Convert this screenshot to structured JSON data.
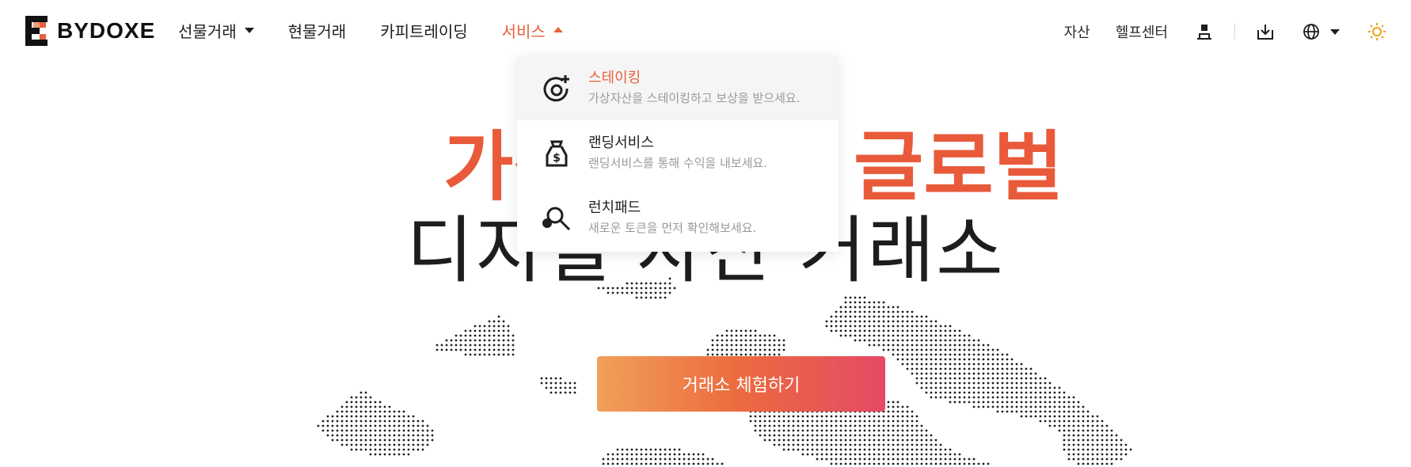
{
  "brand": {
    "name": "BYDOXE",
    "accent": "#e8613c"
  },
  "nav": {
    "items": [
      {
        "label": "선물거래",
        "has_caret": true
      },
      {
        "label": "현물거래"
      },
      {
        "label": "카피트레이딩"
      },
      {
        "label": "서비스",
        "active": true,
        "has_caret": true
      }
    ]
  },
  "right_nav": {
    "assets": "자산",
    "help_center": "헬프센터",
    "icons": [
      "user-icon",
      "download-icon",
      "globe-icon",
      "sun-icon"
    ]
  },
  "dropdown": {
    "items": [
      {
        "title": "스테이킹",
        "desc": "가상자산을 스테이킹하고 보상을 받으세요.",
        "icon": "staking-icon",
        "hovered": true
      },
      {
        "title": "랜딩서비스",
        "desc": "랜딩서비스를 통해 수익을 내보세요.",
        "icon": "lending-bag-icon"
      },
      {
        "title": "런치패드",
        "desc": "새로운 토큰을 먼저 확인해보세요.",
        "icon": "launchpad-search-icon"
      }
    ]
  },
  "hero": {
    "line1_left": "가상",
    "line1_right": "글로벌",
    "line2": "디지털 자산 거래소",
    "cta": "거래소 체험하기"
  }
}
